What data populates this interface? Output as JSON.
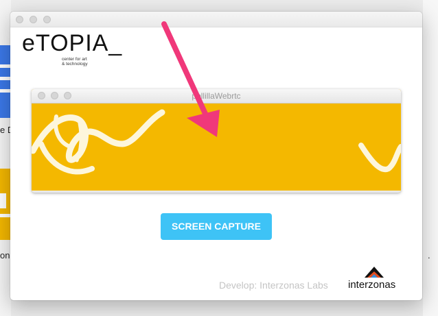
{
  "background": {
    "letters": [
      "e D",
      "ono",
      "."
    ]
  },
  "window": {
    "logo": {
      "brand": "eTOPIA_",
      "tagline_line1": "center for art",
      "tagline_line2": "& technology"
    },
    "capture_window": {
      "title": "pollillaWebrtc",
      "preview_color": "#f4b800"
    },
    "capture_button": {
      "label": "SCREEN CAPTURE",
      "color": "#3ec3f6"
    },
    "footer": {
      "credit": "Develop: Interzonas Labs",
      "brand": "interzonas"
    }
  },
  "annotation": {
    "icon": "pink-arrow-icon",
    "color": "#f0387a"
  }
}
